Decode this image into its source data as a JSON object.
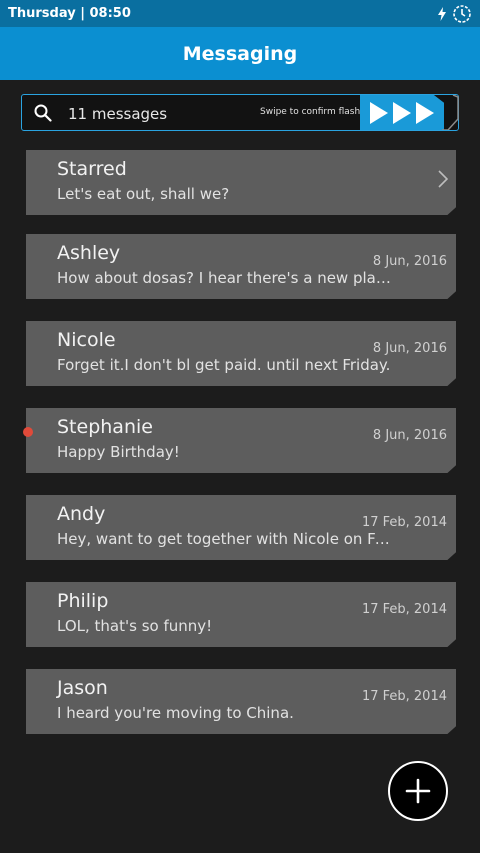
{
  "status_bar": {
    "text": "Thursday | 08:50"
  },
  "app_bar": {
    "title": "Messaging"
  },
  "search": {
    "count_label": "11 messages",
    "swipe_hint": "Swipe to confirm flash"
  },
  "messages": [
    {
      "name": "Starred",
      "preview": "Let's eat out, shall we?",
      "date": ""
    },
    {
      "name": "Ashley",
      "preview": "How about dosas? I hear there's a new place…",
      "date": "8 Jun, 2016"
    },
    {
      "name": "Nicole",
      "preview": "Forget it.I don't bl get paid. until next Friday.",
      "date": "8 Jun, 2016"
    },
    {
      "name": "Stephanie",
      "preview": "Happy Birthday!",
      "date": "8 Jun, 2016"
    },
    {
      "name": "Andy",
      "preview": "Hey, want to get together with Nicole on Frid…",
      "date": "17 Feb, 2014"
    },
    {
      "name": "Philip",
      "preview": "LOL, that's so funny!",
      "date": "17 Feb, 2014"
    },
    {
      "name": "Jason",
      "preview": "I heard you're moving to China.",
      "date": "17 Feb, 2014"
    }
  ],
  "colors": {
    "accent": "#0b8fd1",
    "status_bar": "#0a6fa0",
    "unread": "#e04a3a",
    "card": "#5d5d5d"
  }
}
